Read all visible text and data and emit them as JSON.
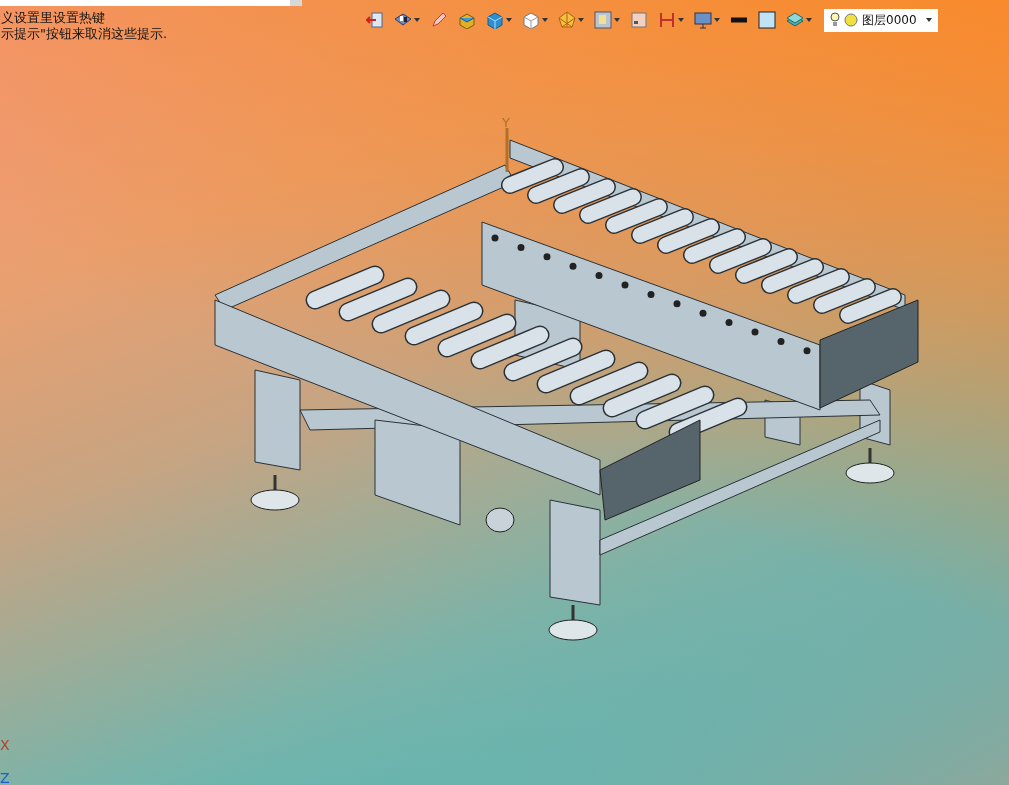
{
  "hints": [
    "义设置里设置热键",
    "示提示\"按钮来取消这些提示."
  ],
  "toolbar": {
    "tools": [
      {
        "dropdown": false
      },
      {
        "dropdown": true
      },
      {
        "dropdown": false
      },
      {
        "dropdown": false
      },
      {
        "dropdown": true
      },
      {
        "dropdown": true
      },
      {
        "dropdown": true
      },
      {
        "dropdown": true
      },
      {
        "dropdown": false
      },
      {
        "dropdown": true
      },
      {
        "dropdown": true
      },
      {
        "dropdown": false
      },
      {
        "dropdown": false
      },
      {
        "dropdown": true
      }
    ],
    "layer_select": {
      "value": "图层0000"
    }
  },
  "viewport": {
    "model_axis_label": "Y",
    "triad_labels": [
      {
        "text": "X",
        "color": "#c0392b"
      },
      {
        "text": "Z",
        "color": "#1a5fd0"
      }
    ]
  }
}
